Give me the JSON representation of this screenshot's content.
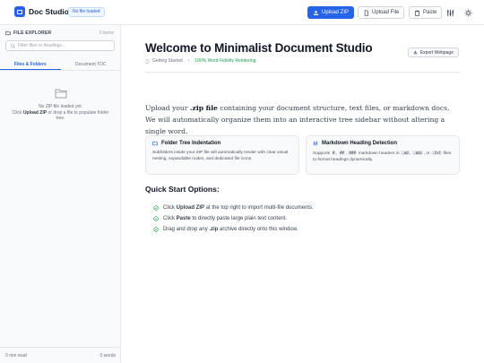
{
  "header": {
    "app_name": "Doc Studio",
    "status_badge": "No file loaded",
    "upload_zip": "Upload ZIP",
    "upload_file": "Upload File",
    "paste": "Paste"
  },
  "sidebar": {
    "title": "FILE EXPLORER",
    "count": "0 items",
    "search_placeholder": "Filter files or headings...",
    "tabs": [
      "Files & Folders",
      "Document TOC"
    ],
    "empty_line1": "No ZIP file loaded yet.",
    "empty_click": "Click ",
    "empty_bold": "Upload ZIP",
    "empty_rest": " or drop a file to populate folder tree.",
    "footer_left": "0 min read",
    "footer_right": "0 words"
  },
  "main": {
    "title": "Welcome to Minimalist Document Studio",
    "breadcrumb": "Getting Started",
    "fidelity": "100% Word-Fidelity Rendering",
    "export": "Export Webpage",
    "intro_pre": "Upload your ",
    "intro_bold": ".zip file",
    "intro_post": " containing your document structure, text files, or markdown docs. We will automatically organize them into an interactive tree sidebar without altering a single word.",
    "cards": [
      {
        "title": "Folder Tree Indentation",
        "body": "Subfolders inside your ZIP file will automatically render with clear visual nesting, expandable nodes, and dedicated file icons."
      },
      {
        "title": "Markdown Heading Detection",
        "body_pre": "Supports ",
        "codes": [
          "#",
          "##",
          "###",
          ".md",
          ".mdx",
          ".txt"
        ],
        "body_mid1": " markdown headers in ",
        "body_mid2": ", or ",
        "body_post": " files to format headings dynamically."
      }
    ],
    "quick_start_title": "Quick Start Options:",
    "quick_start": [
      {
        "pre": "Click ",
        "bold": "Upload ZIP",
        "post": " at the top right to import multi-file documents."
      },
      {
        "pre": "Click ",
        "bold": "Paste",
        "post": " to directly paste large plain text content."
      },
      {
        "pre": "Drag and drop any ",
        "bold": ".zip",
        "post": " archive directly onto this window."
      }
    ]
  },
  "colors": {
    "accent": "#2563eb",
    "success": "#16a34a"
  },
  "icons": [
    "logo-icon",
    "upload-icon",
    "file-icon",
    "paste-icon",
    "settings-icon",
    "theme-icon",
    "folder-icon",
    "search-icon",
    "empty-folder-icon",
    "export-icon",
    "check-icon",
    "hash-icon"
  ]
}
